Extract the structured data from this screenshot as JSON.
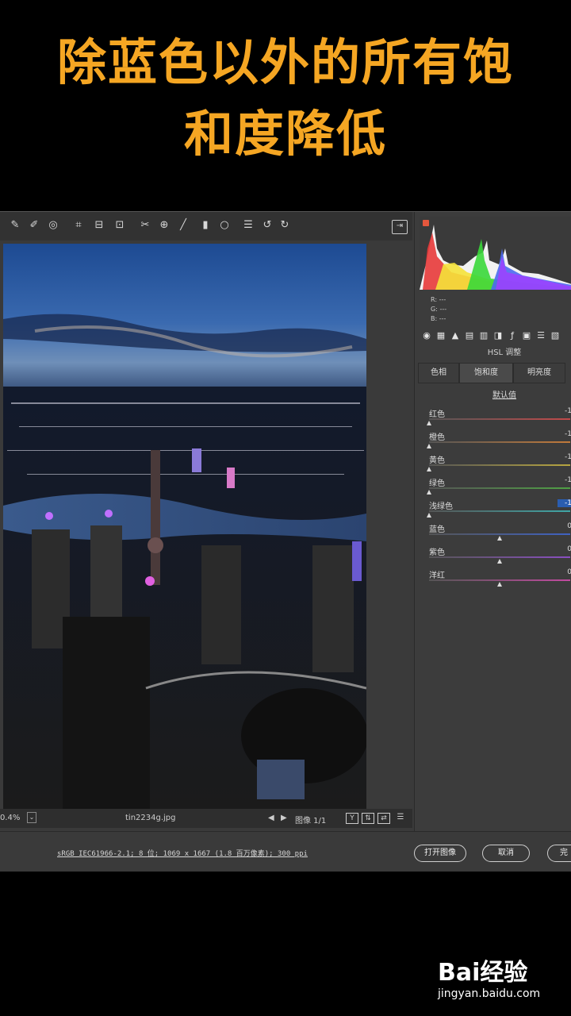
{
  "caption": {
    "line1": "除蓝色以外的所有饱",
    "line2": "和度降低"
  },
  "toolbar": {
    "icons": [
      "eyedropper-icon",
      "color-sampler-icon",
      "target-adjust-icon",
      "crop-icon",
      "straighten-icon",
      "transform-icon",
      "spot-removal-icon",
      "red-eye-icon",
      "brush-icon",
      "graduated-filter-icon",
      "radial-filter-icon",
      "preferences-icon",
      "rotate-left-icon",
      "rotate-right-icon"
    ]
  },
  "histogram": {
    "r_label": "R:",
    "g_label": "G:",
    "b_label": "B:",
    "r_value": "---",
    "g_value": "---",
    "b_value": "---"
  },
  "panel": {
    "title": "HSL 调整",
    "tabs": [
      "色相",
      "饱和度",
      "明亮度"
    ],
    "active_tab": 1,
    "default_link": "默认值",
    "sliders": [
      {
        "label": "红色",
        "value": "-1",
        "pos": 0.0,
        "color": "#c24a4a"
      },
      {
        "label": "橙色",
        "value": "-1",
        "pos": 0.0,
        "color": "#c27a3a"
      },
      {
        "label": "黄色",
        "value": "-1",
        "pos": 0.0,
        "color": "#b8a640"
      },
      {
        "label": "绿色",
        "value": "-1",
        "pos": 0.0,
        "color": "#4fa044"
      },
      {
        "label": "浅绿色",
        "value": "-1",
        "pos": 0.0,
        "color": "#3fa7a7"
      },
      {
        "label": "蓝色",
        "value": "0",
        "pos": 0.5,
        "color": "#3f62c2"
      },
      {
        "label": "紫色",
        "value": "0",
        "pos": 0.5,
        "color": "#8a4fc2"
      },
      {
        "label": "洋红",
        "value": "0",
        "pos": 0.5,
        "color": "#c24aa0"
      }
    ]
  },
  "filmstrip": {
    "zoom": "0.4%",
    "filename": "tin2234g.jpg",
    "image_count": "图像 1/1"
  },
  "footer": {
    "meta": "sRGB IEC61966-2.1; 8 位; 1069 x 1667 (1.8 百万像素); 300 ppi",
    "open_button": "打开图像",
    "cancel_button": "取消",
    "done_button": "完"
  },
  "watermark": {
    "logo": "Bai经验",
    "url": "jingyan.baidu.com"
  }
}
